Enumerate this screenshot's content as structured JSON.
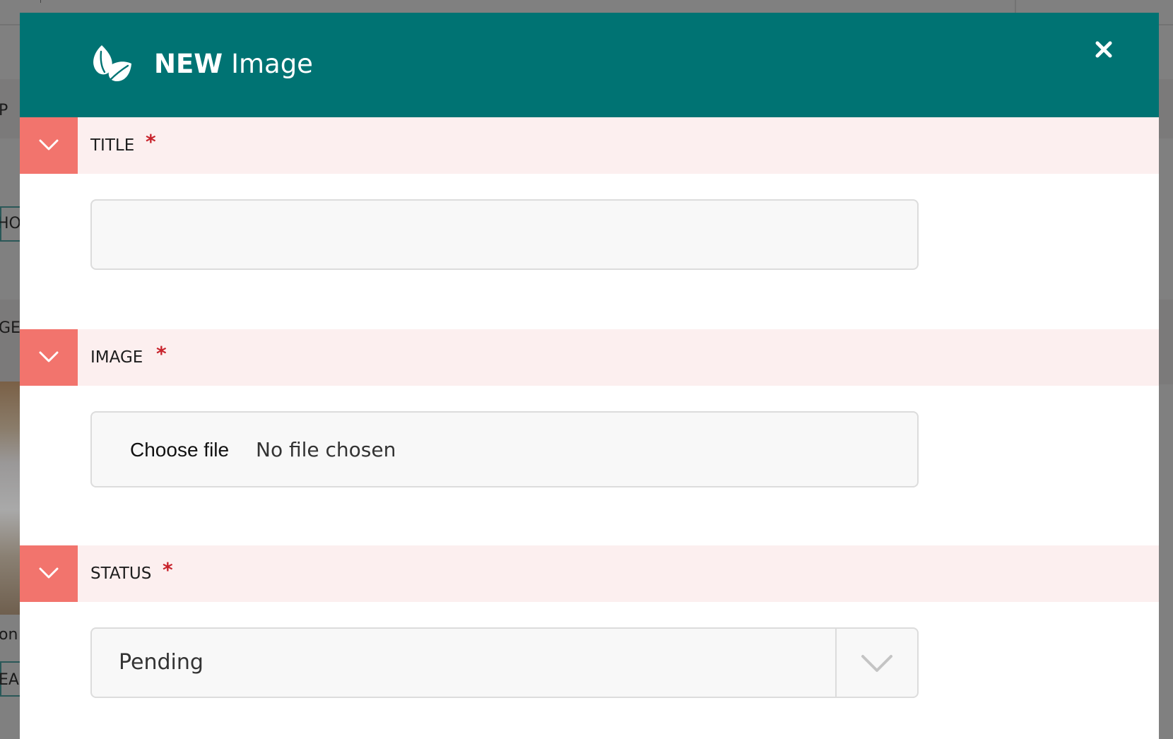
{
  "background": {
    "fragments": [
      "P",
      "HO",
      "GE",
      "on",
      "EA"
    ]
  },
  "modal": {
    "title_strong": "NEW",
    "title_light": "Image",
    "icons": {
      "logo": "leaf-icon",
      "close": "close-icon"
    }
  },
  "sections": [
    {
      "label": "TITLE",
      "required_mark": "*",
      "toggle_icon": "chevron-down-icon"
    },
    {
      "label": "IMAGE",
      "required_mark": "*",
      "toggle_icon": "chevron-down-icon"
    },
    {
      "label": "STATUS",
      "required_mark": "*",
      "toggle_icon": "chevron-down-icon"
    }
  ],
  "fields": {
    "title": {
      "value": "",
      "placeholder": ""
    },
    "image": {
      "button_label": "Choose file",
      "status": "No file chosen"
    },
    "status": {
      "selected": "Pending",
      "arrow_icon": "chevron-down-icon"
    }
  },
  "colors": {
    "header": "#007373",
    "section_band": "#fcefef",
    "toggle": "#f2746d",
    "required": "#c8232c"
  }
}
